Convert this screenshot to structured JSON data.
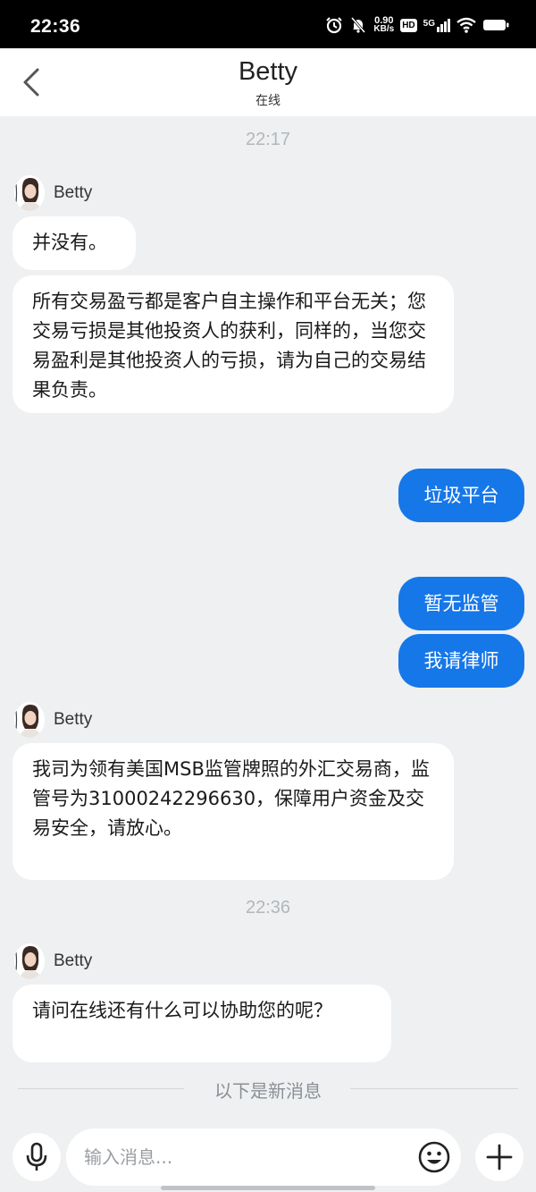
{
  "status_bar": {
    "time": "22:36",
    "net_speed_value": "0.90",
    "net_speed_unit": "KB/s",
    "hd_label": "HD",
    "network_label": "5G",
    "icons": [
      "alarm-icon",
      "mute-icon",
      "signal-icon",
      "wifi-icon",
      "battery-icon"
    ]
  },
  "header": {
    "title": "Betty",
    "subtitle": "在线",
    "back_icon": "chevron-left-icon"
  },
  "chat": {
    "timestamps": [
      "22:17",
      "22:36"
    ],
    "sender_name": "Betty",
    "messages": [
      {
        "from": "Betty",
        "text": "并没有。"
      },
      {
        "from": "Betty",
        "text": "所有交易盈亏都是客户自主操作和平台无关；您交易亏损是其他投资人的获利，同样的，当您交易盈利是其他投资人的亏损，请为自己的交易结果负责。"
      },
      {
        "from": "me",
        "text": "垃圾平台"
      },
      {
        "from": "me",
        "text": "暂无监管"
      },
      {
        "from": "me",
        "text": "我请律师"
      },
      {
        "from": "Betty",
        "text": "我司为领有美国MSB监管牌照的外汇交易商，监管号为31000242296630，保障用户资金及交易安全，请放心。"
      },
      {
        "from": "Betty",
        "text": "请问在线还有什么可以协助您的呢？"
      }
    ],
    "new_messages_divider": "以下是新消息"
  },
  "input_bar": {
    "placeholder": "输入消息...",
    "mic_icon": "microphone-icon",
    "emoji_icon": "emoji-icon",
    "plus_icon": "plus-icon"
  },
  "colors": {
    "background": "#eef0f1",
    "outgoing_bubble": "#1677e8",
    "incoming_bubble": "#ffffff",
    "timestamp": "#b2b7bc"
  }
}
